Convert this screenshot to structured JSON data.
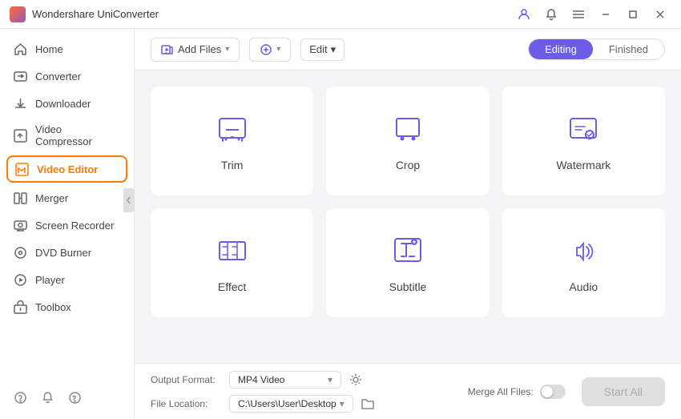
{
  "app": {
    "title": "Wondershare UniConverter",
    "icon": "app-icon"
  },
  "titlebar": {
    "icons": [
      "user-icon",
      "bell-icon",
      "menu-icon",
      "minimize-icon",
      "maximize-icon",
      "close-icon"
    ],
    "minimize": "—",
    "maximize": "□",
    "close": "✕"
  },
  "sidebar": {
    "items": [
      {
        "id": "home",
        "label": "Home",
        "icon": "home-icon"
      },
      {
        "id": "converter",
        "label": "Converter",
        "icon": "converter-icon"
      },
      {
        "id": "downloader",
        "label": "Downloader",
        "icon": "downloader-icon"
      },
      {
        "id": "video-compressor",
        "label": "Video Compressor",
        "icon": "compressor-icon"
      },
      {
        "id": "video-editor",
        "label": "Video Editor",
        "icon": "editor-icon",
        "active": true
      },
      {
        "id": "merger",
        "label": "Merger",
        "icon": "merger-icon"
      },
      {
        "id": "screen-recorder",
        "label": "Screen Recorder",
        "icon": "screen-icon"
      },
      {
        "id": "dvd-burner",
        "label": "DVD Burner",
        "icon": "dvd-icon"
      },
      {
        "id": "player",
        "label": "Player",
        "icon": "player-icon"
      },
      {
        "id": "toolbox",
        "label": "Toolbox",
        "icon": "toolbox-icon"
      }
    ],
    "bottom_icons": [
      "help-icon",
      "bell-icon",
      "feedback-icon"
    ]
  },
  "toolbar": {
    "add_file_label": "Add Files",
    "add_btn_label": "",
    "edit_label": "Edit",
    "tabs": [
      {
        "id": "editing",
        "label": "Editing",
        "active": true
      },
      {
        "id": "finished",
        "label": "Finished",
        "active": false
      }
    ]
  },
  "tools": {
    "row1": [
      {
        "id": "trim",
        "label": "Trim"
      },
      {
        "id": "crop",
        "label": "Crop"
      },
      {
        "id": "watermark",
        "label": "Watermark"
      }
    ],
    "row2": [
      {
        "id": "effect",
        "label": "Effect"
      },
      {
        "id": "subtitle",
        "label": "Subtitle"
      },
      {
        "id": "audio",
        "label": "Audio"
      }
    ]
  },
  "bottom": {
    "output_format_label": "Output Format:",
    "output_format_value": "MP4 Video",
    "file_location_label": "File Location:",
    "file_location_value": "C:\\Users\\User\\Desktop",
    "merge_label": "Merge All Files:",
    "start_label": "Start All"
  }
}
